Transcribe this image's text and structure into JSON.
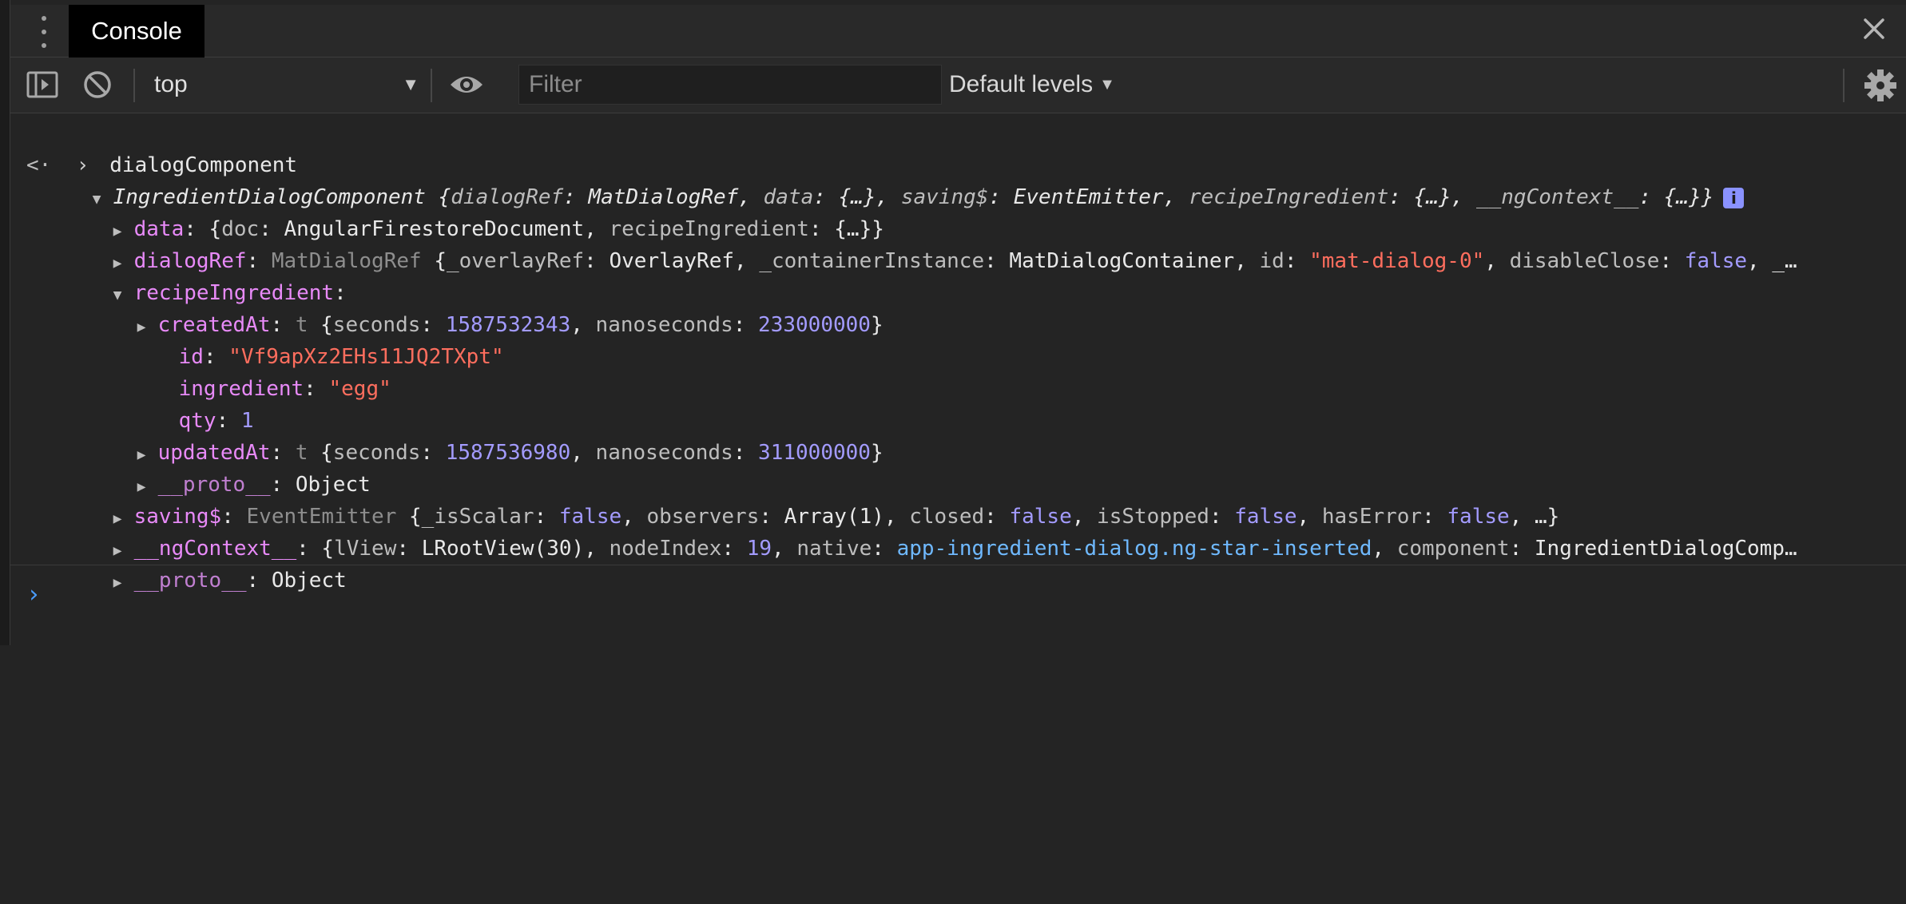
{
  "tabs": {
    "active": "Console"
  },
  "toolbar": {
    "context": "top",
    "filter_placeholder": "Filter",
    "levels": "Default levels"
  },
  "console": {
    "input_command": "dialogComponent",
    "object": {
      "class": "IngredientDialogComponent",
      "preview_open": "{",
      "p1k": "dialogRef",
      "p1v": "MatDialogRef",
      "p2k": "data",
      "p2v": "{…}",
      "p3k": "saving$",
      "p3v": "EventEmitter",
      "p4k": "recipeIngredient",
      "p4v": "{…}",
      "p5k": "__ngContext__",
      "p5v": "{…}",
      "preview_close": "}",
      "badge": "i"
    },
    "data": {
      "key": "data",
      "k1": "doc",
      "v1": "AngularFirestoreDocument",
      "k2": "recipeIngredient",
      "v2": "{…}"
    },
    "dialogRef": {
      "key": "dialogRef",
      "type": "MatDialogRef",
      "k1": "_overlayRef",
      "v1": "OverlayRef",
      "k2": "_containerInstance",
      "v2": "MatDialogContainer",
      "k3": "id",
      "v3": "\"mat-dialog-0\"",
      "k4": "disableClose",
      "v4": "false",
      "tail": "_…"
    },
    "recipeIngredient": {
      "key": "recipeIngredient",
      "createdAt": {
        "key": "createdAt",
        "type": "t",
        "k1": "seconds",
        "v1": "1587532343",
        "k2": "nanoseconds",
        "v2": "233000000"
      },
      "id": {
        "key": "id",
        "value": "\"Vf9apXz2EHs11JQ2TXpt\""
      },
      "ingredient": {
        "key": "ingredient",
        "value": "\"egg\""
      },
      "qty": {
        "key": "qty",
        "value": "1"
      },
      "updatedAt": {
        "key": "updatedAt",
        "type": "t",
        "k1": "seconds",
        "v1": "1587536980",
        "k2": "nanoseconds",
        "v2": "311000000"
      },
      "proto": {
        "key": "__proto__",
        "value": "Object"
      }
    },
    "saving": {
      "key": "saving$",
      "type": "EventEmitter",
      "k1": "_isScalar",
      "v1": "false",
      "k2": "observers",
      "v2": "Array(1)",
      "k3": "closed",
      "v3": "false",
      "k4": "isStopped",
      "v4": "false",
      "k5": "hasError",
      "v5": "false",
      "tail": "…"
    },
    "ngContext": {
      "key": "__ngContext__",
      "k1": "lView",
      "v1": "LRootView(30)",
      "k2": "nodeIndex",
      "v2": "19",
      "k3": "native",
      "v3": "app-ingredient-dialog.ng-star-inserted",
      "k4": "component",
      "v4": "IngredientDialogComp…"
    },
    "proto": {
      "key": "__proto__",
      "value": "Object"
    }
  }
}
